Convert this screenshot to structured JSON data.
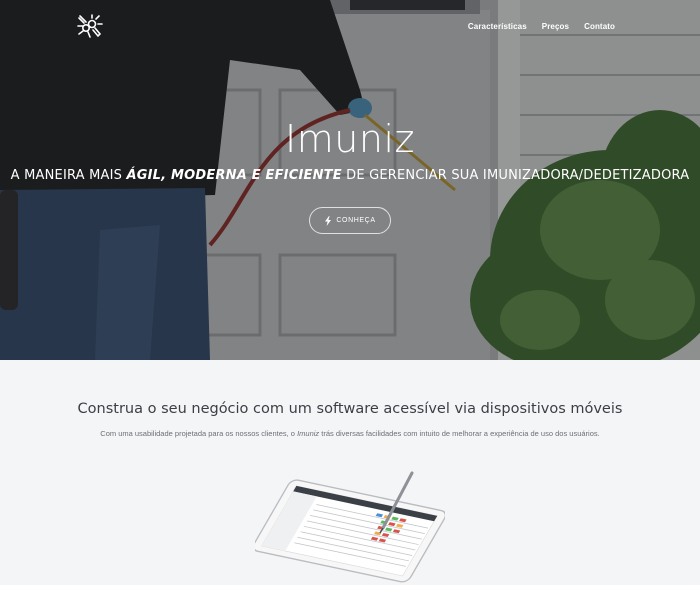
{
  "nav": {
    "logo_icon": "pest-control-logo-icon",
    "links": [
      "Características",
      "Preços",
      "Contato"
    ]
  },
  "hero": {
    "title": "Imuniz",
    "subtitle_before": "A MANEIRA MAIS ",
    "subtitle_highlight": "ÁGIL, MODERNA E EFICIENTE",
    "subtitle_after": " DE GERENCIAR SUA IMUNIZADORA/DEDETIZADORA",
    "cta_label": "CONHEÇA",
    "cta_icon": "lightning-bolt-icon"
  },
  "feature": {
    "title": "Construa o seu negócio com um software acessível via dispositivos móveis",
    "text_before": "Com uma usabilidade projetada para os nossos clientes, o ",
    "text_brand": "Imuniz",
    "text_after": " trás diversas facilidades com intuito de melhorar a experiência de uso dos usuários.",
    "image_icon": "tablet-with-stylus-illustration"
  },
  "colors": {
    "text_white": "#ffffff",
    "section_bg": "#f4f5f7",
    "heading": "#3b3f44",
    "muted_text": "#6b6f74"
  }
}
